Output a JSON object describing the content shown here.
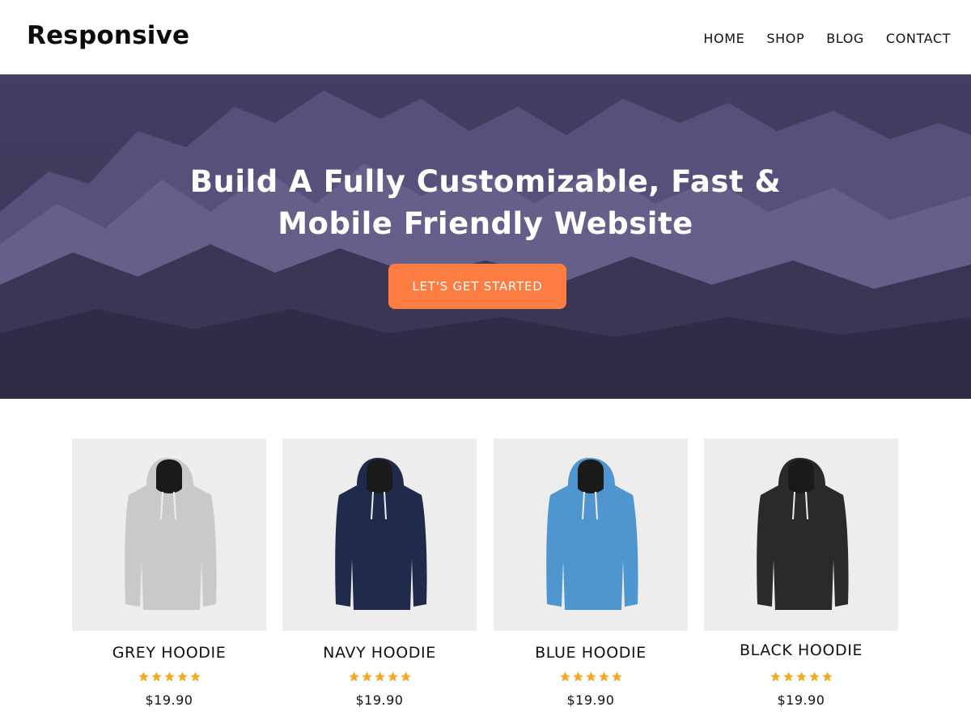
{
  "header": {
    "logo": "Responsive",
    "nav": [
      {
        "label": "HOME"
      },
      {
        "label": "SHOP"
      },
      {
        "label": "BLOG"
      },
      {
        "label": "CONTACT"
      }
    ]
  },
  "hero": {
    "title_line1": "Build A Fully Customizable, Fast &",
    "title_line2": "Mobile Friendly Website",
    "cta_label": "LET'S GET STARTED",
    "overlay_color": "#3b3858",
    "cta_color": "#fd7c42"
  },
  "products": [
    {
      "title": "GREY HOODIE",
      "price": "$19.90",
      "rating": 5,
      "rating_max": 5,
      "hoodie_color": "#c9c9c9"
    },
    {
      "title": "NAVY HOODIE",
      "price": "$19.90",
      "rating": 5,
      "rating_max": 5,
      "hoodie_color": "#202a4a"
    },
    {
      "title": "BLUE HOODIE",
      "price": "$19.90",
      "rating": 5,
      "rating_max": 5,
      "hoodie_color": "#4f95cf"
    },
    {
      "title": "BLACK HOODIE",
      "price": "$19.90",
      "rating": 5,
      "rating_max": 5,
      "hoodie_color": "#2a2a2a"
    }
  ],
  "star_color": "#f5a623"
}
